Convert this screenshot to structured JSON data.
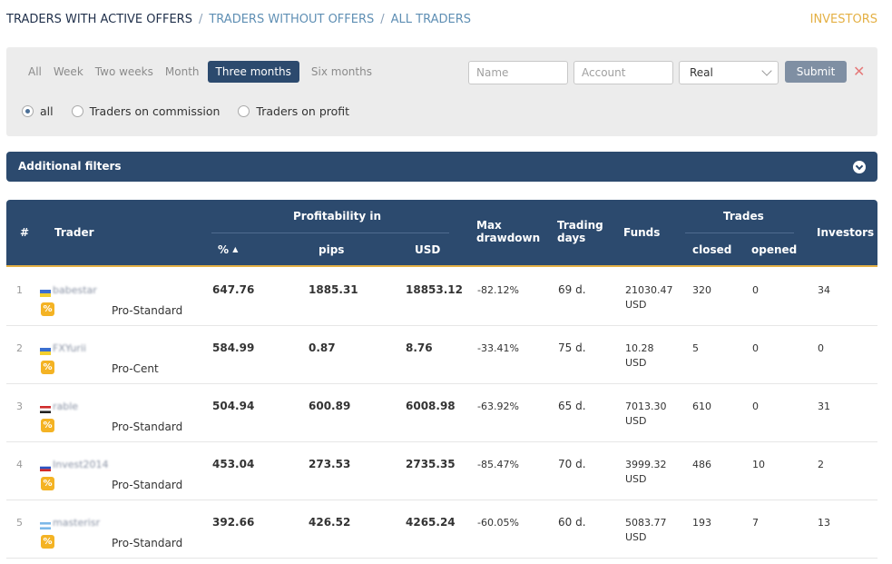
{
  "nav": {
    "active": "TRADERS WITH ACTIVE OFFERS",
    "sep": "/",
    "without": "TRADERS WITHOUT OFFERS",
    "all": "ALL TRADERS",
    "investors": "INVESTORS"
  },
  "filters": {
    "periods": [
      "All",
      "Week",
      "Two weeks",
      "Month",
      "Three months",
      "Six months"
    ],
    "active_period": "Three months",
    "name_placeholder": "Name",
    "account_placeholder": "Account",
    "account_type": "Real",
    "submit_label": "Submit",
    "clear_glyph": "✕",
    "radios": [
      "all",
      "Traders on commission",
      "Traders on profit"
    ],
    "radio_selected": "all"
  },
  "additional_filters": "Additional filters",
  "table": {
    "headers": {
      "index": "#",
      "trader": "Trader",
      "profitability": "Profitability in",
      "percent": "%",
      "pips": "pips",
      "usd": "USD",
      "max_drawdown_1": "Max",
      "max_drawdown_2": "drawdown",
      "trading_days_1": "Trading",
      "trading_days_2": "days",
      "funds": "Funds",
      "trades": "Trades",
      "closed": "closed",
      "opened": "opened",
      "investors": "Investors"
    },
    "sort_arrow": "▲",
    "rows": [
      {
        "index": "1",
        "trader": "babestar",
        "flag": "ua",
        "badge": "%",
        "account": "Pro-Standard",
        "percent": "647.76",
        "pips": "1885.31",
        "usd": "18853.12",
        "drawdown": "-82.12%",
        "days": "69 d.",
        "funds": "21030.47",
        "funds_cur": "USD",
        "closed": "320",
        "opened": "0",
        "investors": "34"
      },
      {
        "index": "2",
        "trader": "FXYurii",
        "flag": "ua",
        "badge": "%",
        "account": "Pro-Cent",
        "percent": "584.99",
        "pips": "0.87",
        "usd": "8.76",
        "drawdown": "-33.41%",
        "days": "75 d.",
        "funds": "10.28",
        "funds_cur": "USD",
        "closed": "5",
        "opened": "0",
        "investors": "0"
      },
      {
        "index": "3",
        "trader": "rable",
        "flag": "eg",
        "badge": "%",
        "account": "Pro-Standard",
        "percent": "504.94",
        "pips": "600.89",
        "usd": "6008.98",
        "drawdown": "-63.92%",
        "days": "65 d.",
        "funds": "7013.30",
        "funds_cur": "USD",
        "closed": "610",
        "opened": "0",
        "investors": "31"
      },
      {
        "index": "4",
        "trader": "Invest2014",
        "flag": "ru",
        "badge": "%",
        "account": "Pro-Standard",
        "percent": "453.04",
        "pips": "273.53",
        "usd": "2735.35",
        "drawdown": "-85.47%",
        "days": "70 d.",
        "funds": "3999.32",
        "funds_cur": "USD",
        "closed": "486",
        "opened": "10",
        "investors": "2"
      },
      {
        "index": "5",
        "trader": "masterisr",
        "flag": "ar",
        "badge": "%",
        "account": "Pro-Standard",
        "percent": "392.66",
        "pips": "426.52",
        "usd": "4265.24",
        "drawdown": "-60.05%",
        "days": "60 d.",
        "funds": "5083.77",
        "funds_cur": "USD",
        "closed": "193",
        "opened": "7",
        "investors": "13"
      }
    ]
  },
  "colors": {
    "navy": "#2c4a6e",
    "gold": "#e4b044",
    "badge": "#f4b324",
    "link": "#5f8fb4"
  }
}
